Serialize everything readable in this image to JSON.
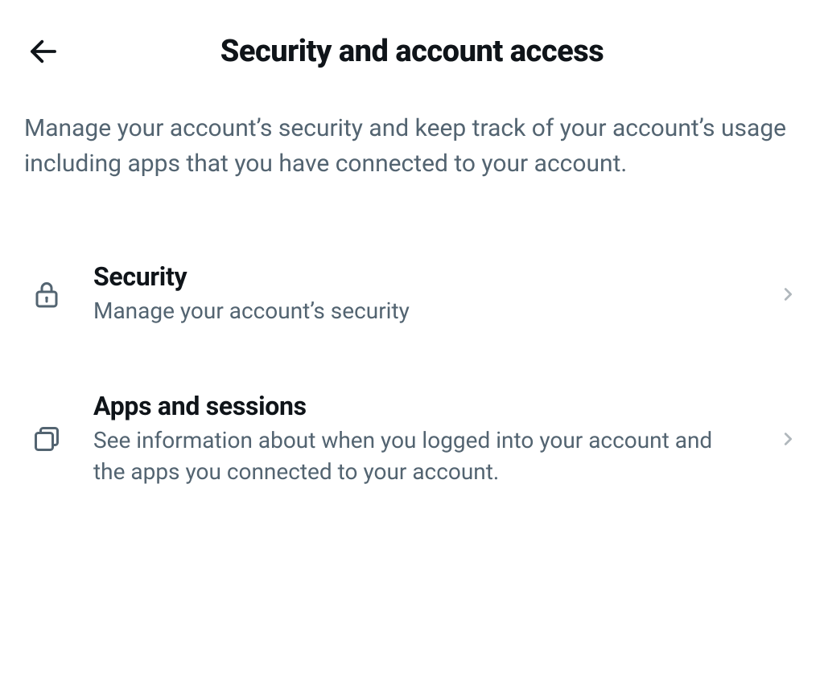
{
  "header": {
    "title": "Security and account access"
  },
  "description": "Manage your account’s security and keep track of your account’s usage including apps that you have connected to your account.",
  "items": [
    {
      "title": "Security",
      "subtitle": "Manage your account’s security"
    },
    {
      "title": "Apps and sessions",
      "subtitle": "See information about when you logged into your account and the apps you connected to your account."
    }
  ]
}
